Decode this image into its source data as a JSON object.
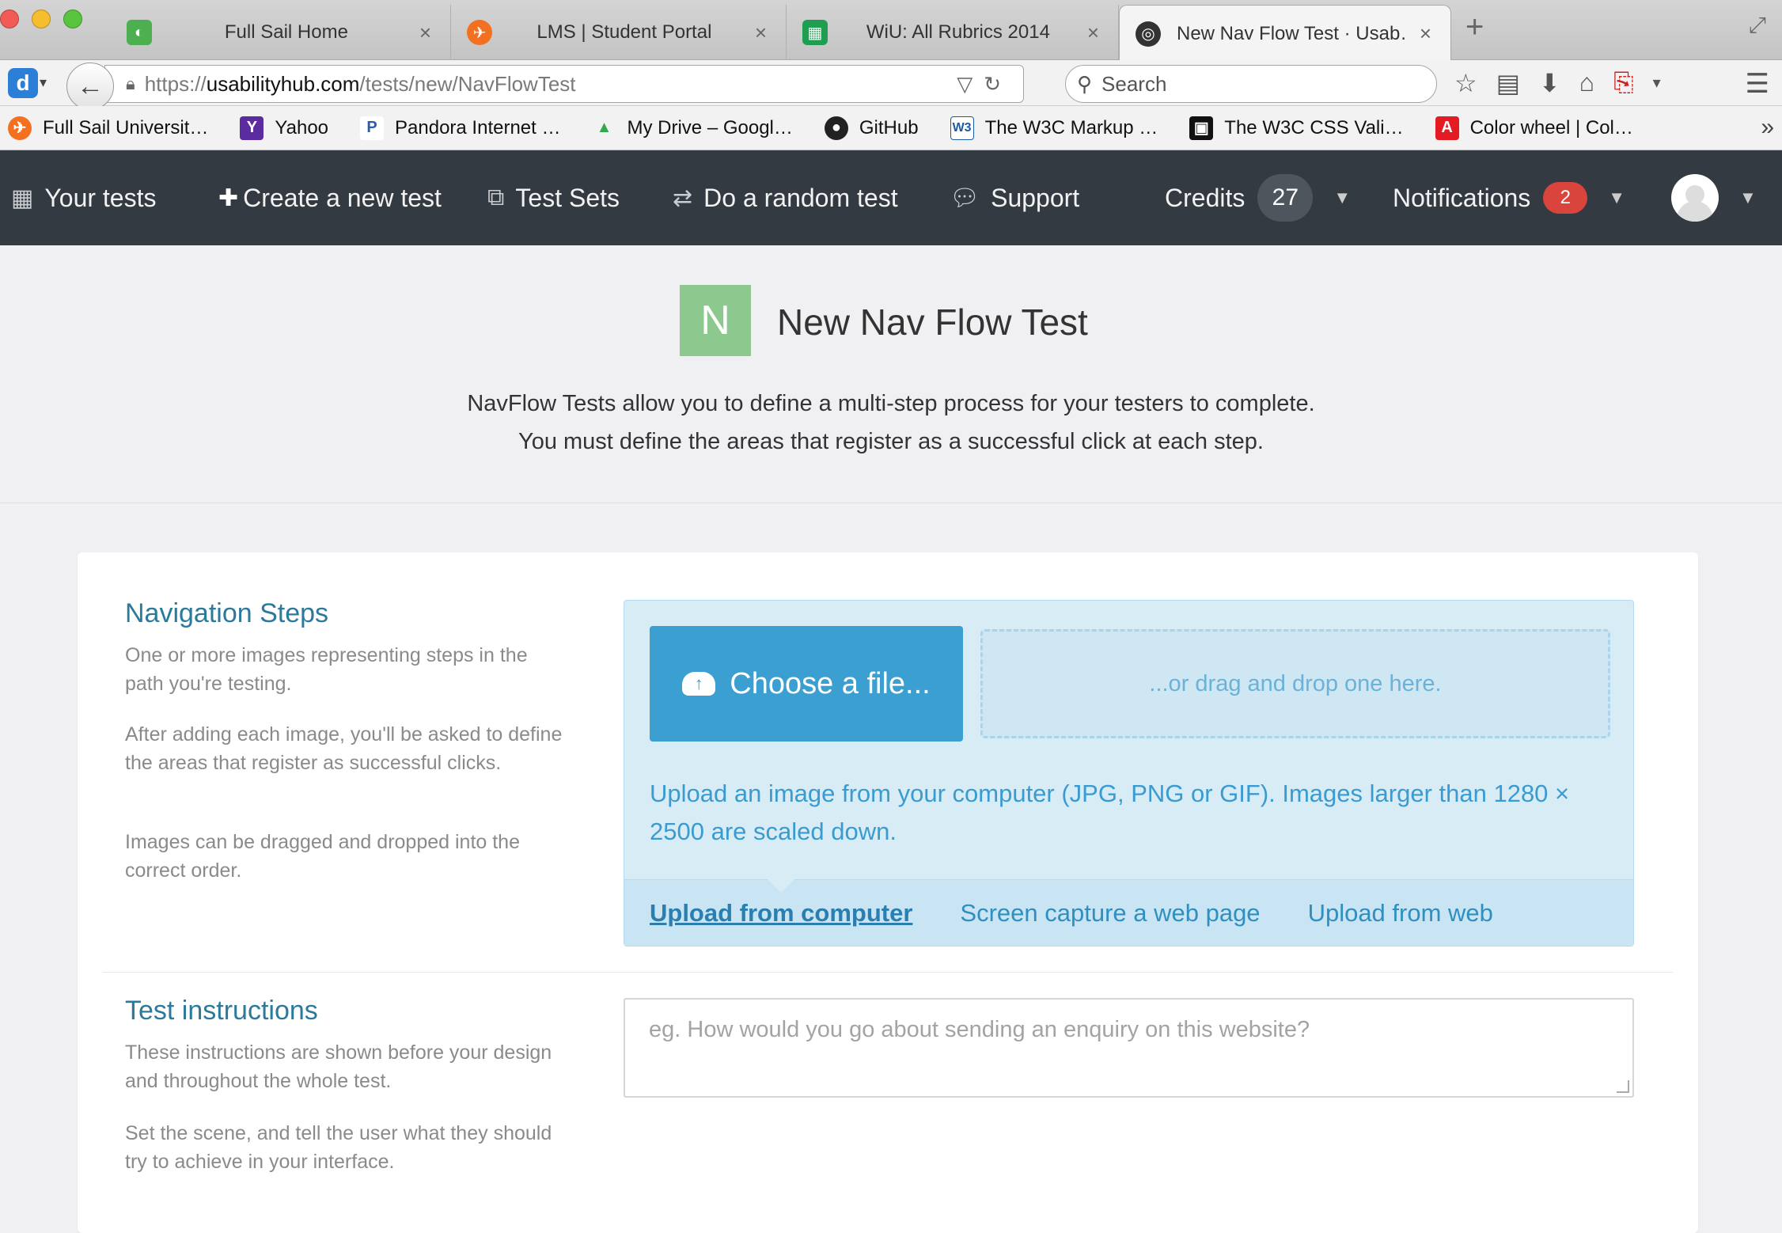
{
  "browser": {
    "tabs": [
      {
        "title": "Full Sail Home",
        "icon": "fullsail-icon",
        "color": "#4caf50"
      },
      {
        "title": "LMS | Student Portal",
        "icon": "lms-icon",
        "color": "#f37021"
      },
      {
        "title": "WiU: All Rubrics 2014",
        "icon": "sheets-icon",
        "color": "#1e9e50"
      },
      {
        "title": "New Nav Flow Test · Usab…",
        "icon": "usabilityhub-icon",
        "color": "#333333"
      }
    ],
    "url_scheme": "https://",
    "url_host": "usabilityhub.com",
    "url_path": "/tests/new/NavFlowTest",
    "search_placeholder": "Search",
    "bookmarks": [
      {
        "label": "Full Sail Universit…",
        "icon": "fullsail-bookmark-icon",
        "glyph": "✈",
        "color": "#f37021"
      },
      {
        "label": "Yahoo",
        "icon": "yahoo-icon",
        "glyph": "Y",
        "color": "#5b2ca0"
      },
      {
        "label": "Pandora Internet …",
        "icon": "pandora-icon",
        "glyph": "P",
        "color": "#2a5dab"
      },
      {
        "label": "My Drive – Googl…",
        "icon": "drive-icon",
        "glyph": "▲",
        "color": "#2fa84f"
      },
      {
        "label": "GitHub",
        "icon": "github-icon",
        "glyph": "●",
        "color": "#222222"
      },
      {
        "label": "The W3C Markup …",
        "icon": "w3c-icon",
        "glyph": "W3",
        "color": "#1a5aa6"
      },
      {
        "label": "The W3C CSS Vali…",
        "icon": "w3c-css-icon",
        "glyph": "▣",
        "color": "#111111"
      },
      {
        "label": "Color wheel | Col…",
        "icon": "adobe-icon",
        "glyph": "A",
        "color": "#e41b23"
      }
    ]
  },
  "appnav": {
    "your_tests": "Your tests",
    "create": "Create a new test",
    "test_sets": "Test Sets",
    "random": "Do a random test",
    "support": "Support",
    "credits_label": "Credits",
    "credits_value": "27",
    "notifications_label": "Notifications",
    "notifications_count": "2"
  },
  "header": {
    "badge": "N",
    "title": "New Nav Flow Test",
    "intro_line1": "NavFlow Tests allow you to define a multi-step process for your testers to complete.",
    "intro_line2": "You must define the areas that register as a successful click at each step."
  },
  "nav_steps": {
    "title": "Navigation Steps",
    "p1": "One or more images representing steps in the path you're testing.",
    "p2": "After adding each image, you'll be asked to define the areas that register as successful clicks.",
    "p3": "Images can be dragged and dropped into the correct order."
  },
  "upload": {
    "choose_label": "Choose a file...",
    "drop_label": "...or drag and drop one here.",
    "help": "Upload an image from your computer (JPG, PNG or GIF). Images larger than 1280 × 2500 are scaled down.",
    "tabs": [
      "Upload from computer",
      "Screen capture a web page",
      "Upload from web"
    ]
  },
  "instructions": {
    "title": "Test instructions",
    "p1": "These instructions are shown before your design and throughout the whole test.",
    "p2": "Set the scene, and tell the user what they should try to achieve in your interface.",
    "placeholder": "eg. How would you go about sending an enquiry on this website?"
  }
}
